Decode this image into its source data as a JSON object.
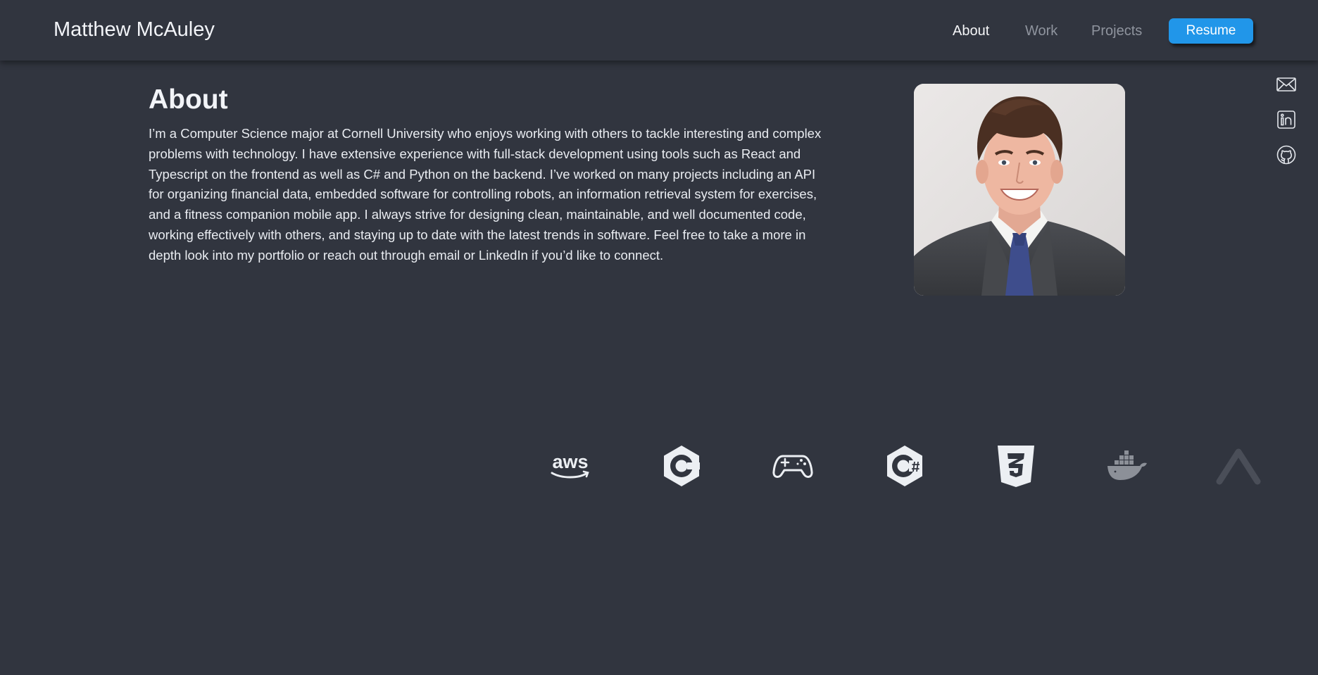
{
  "header": {
    "site_name": "Matthew McAuley",
    "nav": {
      "about": "About",
      "work": "Work",
      "projects": "Projects"
    },
    "resume_label": "Resume",
    "colors": {
      "background": "#31353f",
      "accent": "#2196e9",
      "active_link": "#f5f6f8",
      "inactive_link": "#8f949e"
    }
  },
  "social": {
    "icons": [
      "mail-icon",
      "linkedin-icon",
      "github-icon"
    ]
  },
  "about": {
    "title": "About",
    "paragraph": "I’m a Computer Science major at Cornell University who enjoys working with others to tackle interesting and complex problems with technology. I have extensive experience with full-stack development using tools such as React and Typescript on the frontend as well as C# and Python on the backend. I’ve worked on many projects including an API for organizing financial data, embedded software for controlling robots, an information retrieval system for exercises, and a fitness companion mobile app. I always strive for designing clean, maintainable, and well documented code, working effectively with others, and staying up to date with the latest trends in software. Feel free to take a more in depth look into my portfolio or reach out through email or LinkedIn if you’d like to connect.",
    "photo": "portrait-photo"
  },
  "tech_logos": {
    "items": [
      "aws-logo-icon",
      "c-language-logo-icon",
      "gamepad-icon",
      "csharp-logo-icon",
      "css3-logo-icon",
      "docker-logo-icon",
      "caret-up-logo-icon"
    ],
    "aws_text": "aws"
  }
}
